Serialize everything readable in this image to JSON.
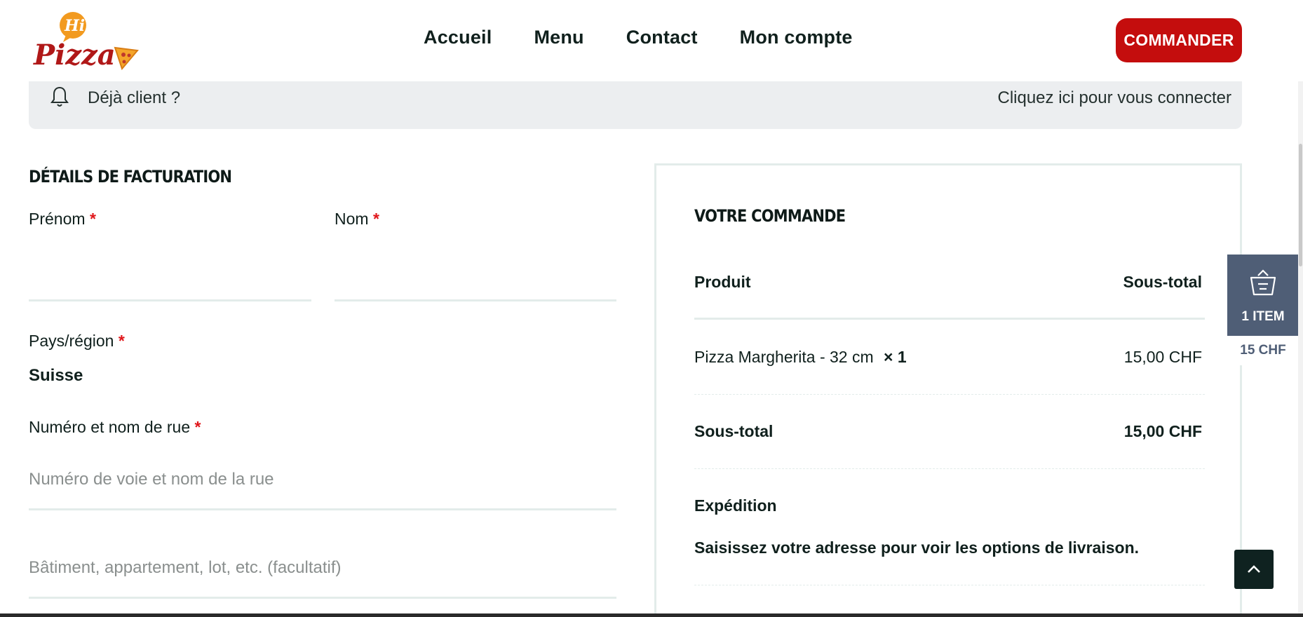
{
  "header": {
    "logo_text": "Hi Pizza",
    "nav": [
      "Accueil",
      "Menu",
      "Contact",
      "Mon compte"
    ],
    "order_button": "COMMANDER"
  },
  "notice": {
    "question": "Déjà client ?",
    "login_link": "Cliquez ici pour vous connecter"
  },
  "billing": {
    "title": "DÉTAILS DE FACTURATION",
    "first_name_label": "Prénom",
    "last_name_label": "Nom",
    "country_label": "Pays/région",
    "country_value": "Suisse",
    "street_label": "Numéro et nom de rue",
    "street_placeholder": "Numéro de voie et nom de la rue",
    "street2_placeholder": "Bâtiment, appartement, lot, etc. (facultatif)",
    "required_mark": "*"
  },
  "order": {
    "title": "VOTRE COMMANDE",
    "col_product": "Produit",
    "col_subtotal": "Sous-total",
    "item_name": "Pizza Margherita - 32 cm",
    "item_qty": "× 1",
    "item_price": "15,00 CHF",
    "subtotal_label": "Sous-total",
    "subtotal_value": "15,00 CHF",
    "shipping_label": "Expédition",
    "shipping_note": "Saisissez votre adresse pour voir les options de livraison."
  },
  "cart": {
    "count": "1 ITEM",
    "total": "15 CHF"
  },
  "colors": {
    "brand_red": "#c40d0d",
    "cart_slate": "#4f5e76",
    "dark": "#0f2220"
  }
}
